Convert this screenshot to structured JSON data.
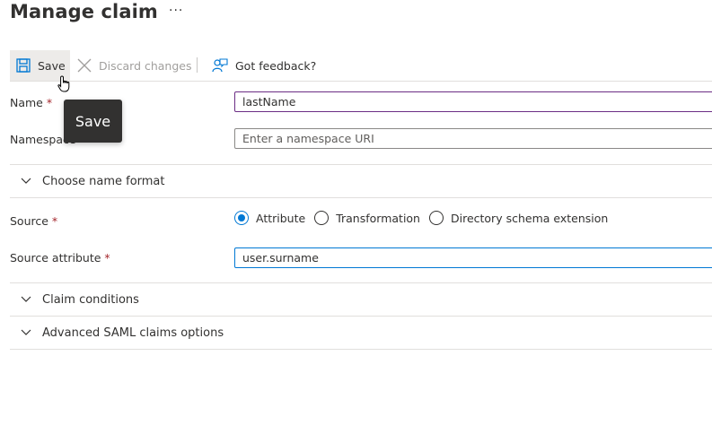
{
  "page": {
    "title": "Manage claim",
    "more_label": "···"
  },
  "toolbar": {
    "save_label": "Save",
    "discard_label": "Discard changes",
    "feedback_label": "Got feedback?"
  },
  "tooltip": {
    "text": "Save"
  },
  "form": {
    "name": {
      "label": "Name",
      "required_mark": "*",
      "value": "lastName"
    },
    "namespace": {
      "label": "Namespace",
      "placeholder": "Enter a namespace URI"
    },
    "choose_name_format": {
      "label": "Choose name format"
    },
    "source": {
      "label": "Source",
      "required_mark": "*",
      "options": [
        "Attribute",
        "Transformation",
        "Directory schema extension"
      ],
      "selected": "Attribute"
    },
    "source_attribute": {
      "label": "Source attribute",
      "required_mark": "*",
      "value": "user.surname"
    },
    "claim_conditions": {
      "label": "Claim conditions"
    },
    "advanced_saml": {
      "label": "Advanced SAML claims options"
    }
  },
  "colors": {
    "accent": "#0078d4",
    "required": "#a4262c",
    "name_focus_border": "#6b2d84",
    "tooltip_bg": "#323130"
  }
}
